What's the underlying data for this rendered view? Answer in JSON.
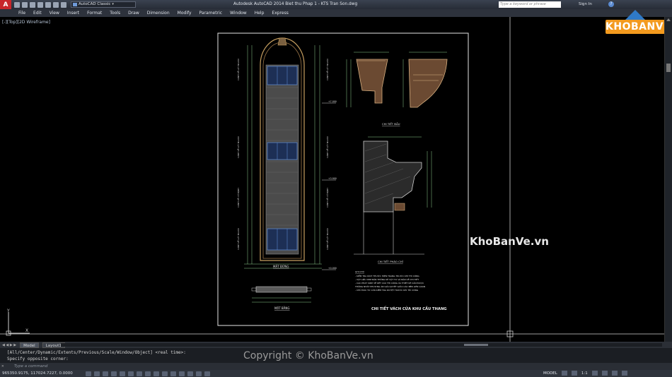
{
  "titlebar": {
    "app_letter": "A",
    "workspace": "AutoCAD Classic",
    "title": "Autodesk AutoCAD 2014    Biet thu Phap 1 - KTS Tran Son.dwg",
    "search_placeholder": "Type a keyword or phrase",
    "sign_in": "Sign In",
    "help": "?"
  },
  "menu": [
    "File",
    "Edit",
    "View",
    "Insert",
    "Format",
    "Tools",
    "Draw",
    "Dimension",
    "Modify",
    "Parametric",
    "Window",
    "Help",
    "Express"
  ],
  "brand": {
    "text": "KHOBANVE"
  },
  "viewport_label": "[-][Top][2D Wireframe]",
  "drawing": {
    "label_elevation": "MẶT ĐỨNG",
    "label_plan": "MẶT BẰNG",
    "label_detail_top": "CHI TIẾT ĐẦU",
    "label_detail_section": "CHI TIẾT PHÀO CHỈ",
    "main_title": "CHI TIẾT VÁCH CỬA KHU CẦU THANG",
    "notes_title": "GHI CHÚ",
    "notes": [
      "- KIỂM TRA KÍCH THƯỚC HIỆN TRẠNG TRƯỚC KHI THI CÔNG",
      "- VẬT LIỆU XEM BẢN THỐNG KÊ VẬT TƯ VÀ BẢN VẼ CHI TIẾT",
      "- CÁC PHÁT SINH VỀ KẾT CẤU THI CÔNG VÀ THIẾT KẾ CẦN ĐƯỢC",
      "  THỐNG NHẤT PHƯƠNG ÁN GIẢI QUYẾT GIỮA CÁC BÊN LIÊN QUAN",
      "- CHỦ ĐẦU TƯ CẦN KIỂM TRA DUYỆT TRƯỚC KHI THI CÔNG"
    ],
    "levels": [
      "+7.000",
      "+3.900",
      "+0.000"
    ]
  },
  "tabs": [
    "Model",
    "Layout1"
  ],
  "command": {
    "line1": "[All/Center/Dynamic/Extents/Previous/Scale/Window/Object] <real time>:",
    "line2": "Specify opposite corner:",
    "placeholder": "Type a command"
  },
  "status": {
    "coords": "965350.9175, 117024.7227, 0.0000",
    "model": "MODEL",
    "scale": "1:1"
  },
  "watermark_mid": "KhoBanVe.vn",
  "watermark_bottom": "Copyright © KhoBanVe.vn",
  "colors": {
    "accent": "#f39a1e",
    "brand_blue": "#2f7ac8",
    "canvas": "#000000"
  }
}
